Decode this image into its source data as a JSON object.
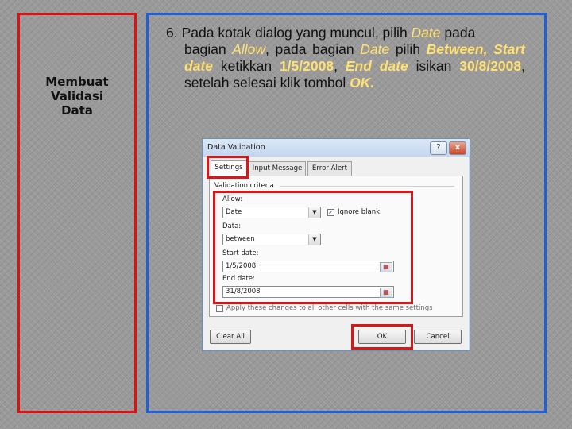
{
  "sidebar": {
    "title": "Membuat\nValidasi\nData"
  },
  "instruction": {
    "step": "6.",
    "parts": {
      "p1": "Pada kotak dialog yang muncul, pilih ",
      "date1": "Date",
      "p2": " pada",
      "p3": "bagian ",
      "allow": "Allow",
      "p4": ", pada bagian ",
      "date2": "Date",
      "p5": " pilih ",
      "between": "Between,",
      "start": "Start date",
      "p6": " ketikkan ",
      "startval": "1/5/2008",
      "p7": ", ",
      "end": "End date",
      "p8": " isikan",
      "endval": "30/8/2008",
      "p9": ", setelah selesai klik tombol ",
      "ok": "OK."
    }
  },
  "dialog": {
    "title": "Data Validation",
    "help_label": "?",
    "close_label": "x",
    "tabs": [
      "Settings",
      "Input Message",
      "Error Alert"
    ],
    "group_label": "Validation criteria",
    "allow_label": "Allow:",
    "allow_value": "Date",
    "ignore_blank_label": "Ignore blank",
    "ignore_blank_checked": "✓",
    "data_label": "Data:",
    "data_value": "between",
    "start_label": "Start date:",
    "start_value": "1/5/2008",
    "end_label": "End date:",
    "end_value": "31/8/2008",
    "apply_label": "Apply these changes to all other cells with the same settings",
    "clear_all_label": "Clear All",
    "ok_label": "OK",
    "cancel_label": "Cancel"
  },
  "colors": {
    "left_border": "#e01010",
    "right_border": "#1e5fe0",
    "highlight": "#ffe070",
    "callout": "#d81818"
  }
}
